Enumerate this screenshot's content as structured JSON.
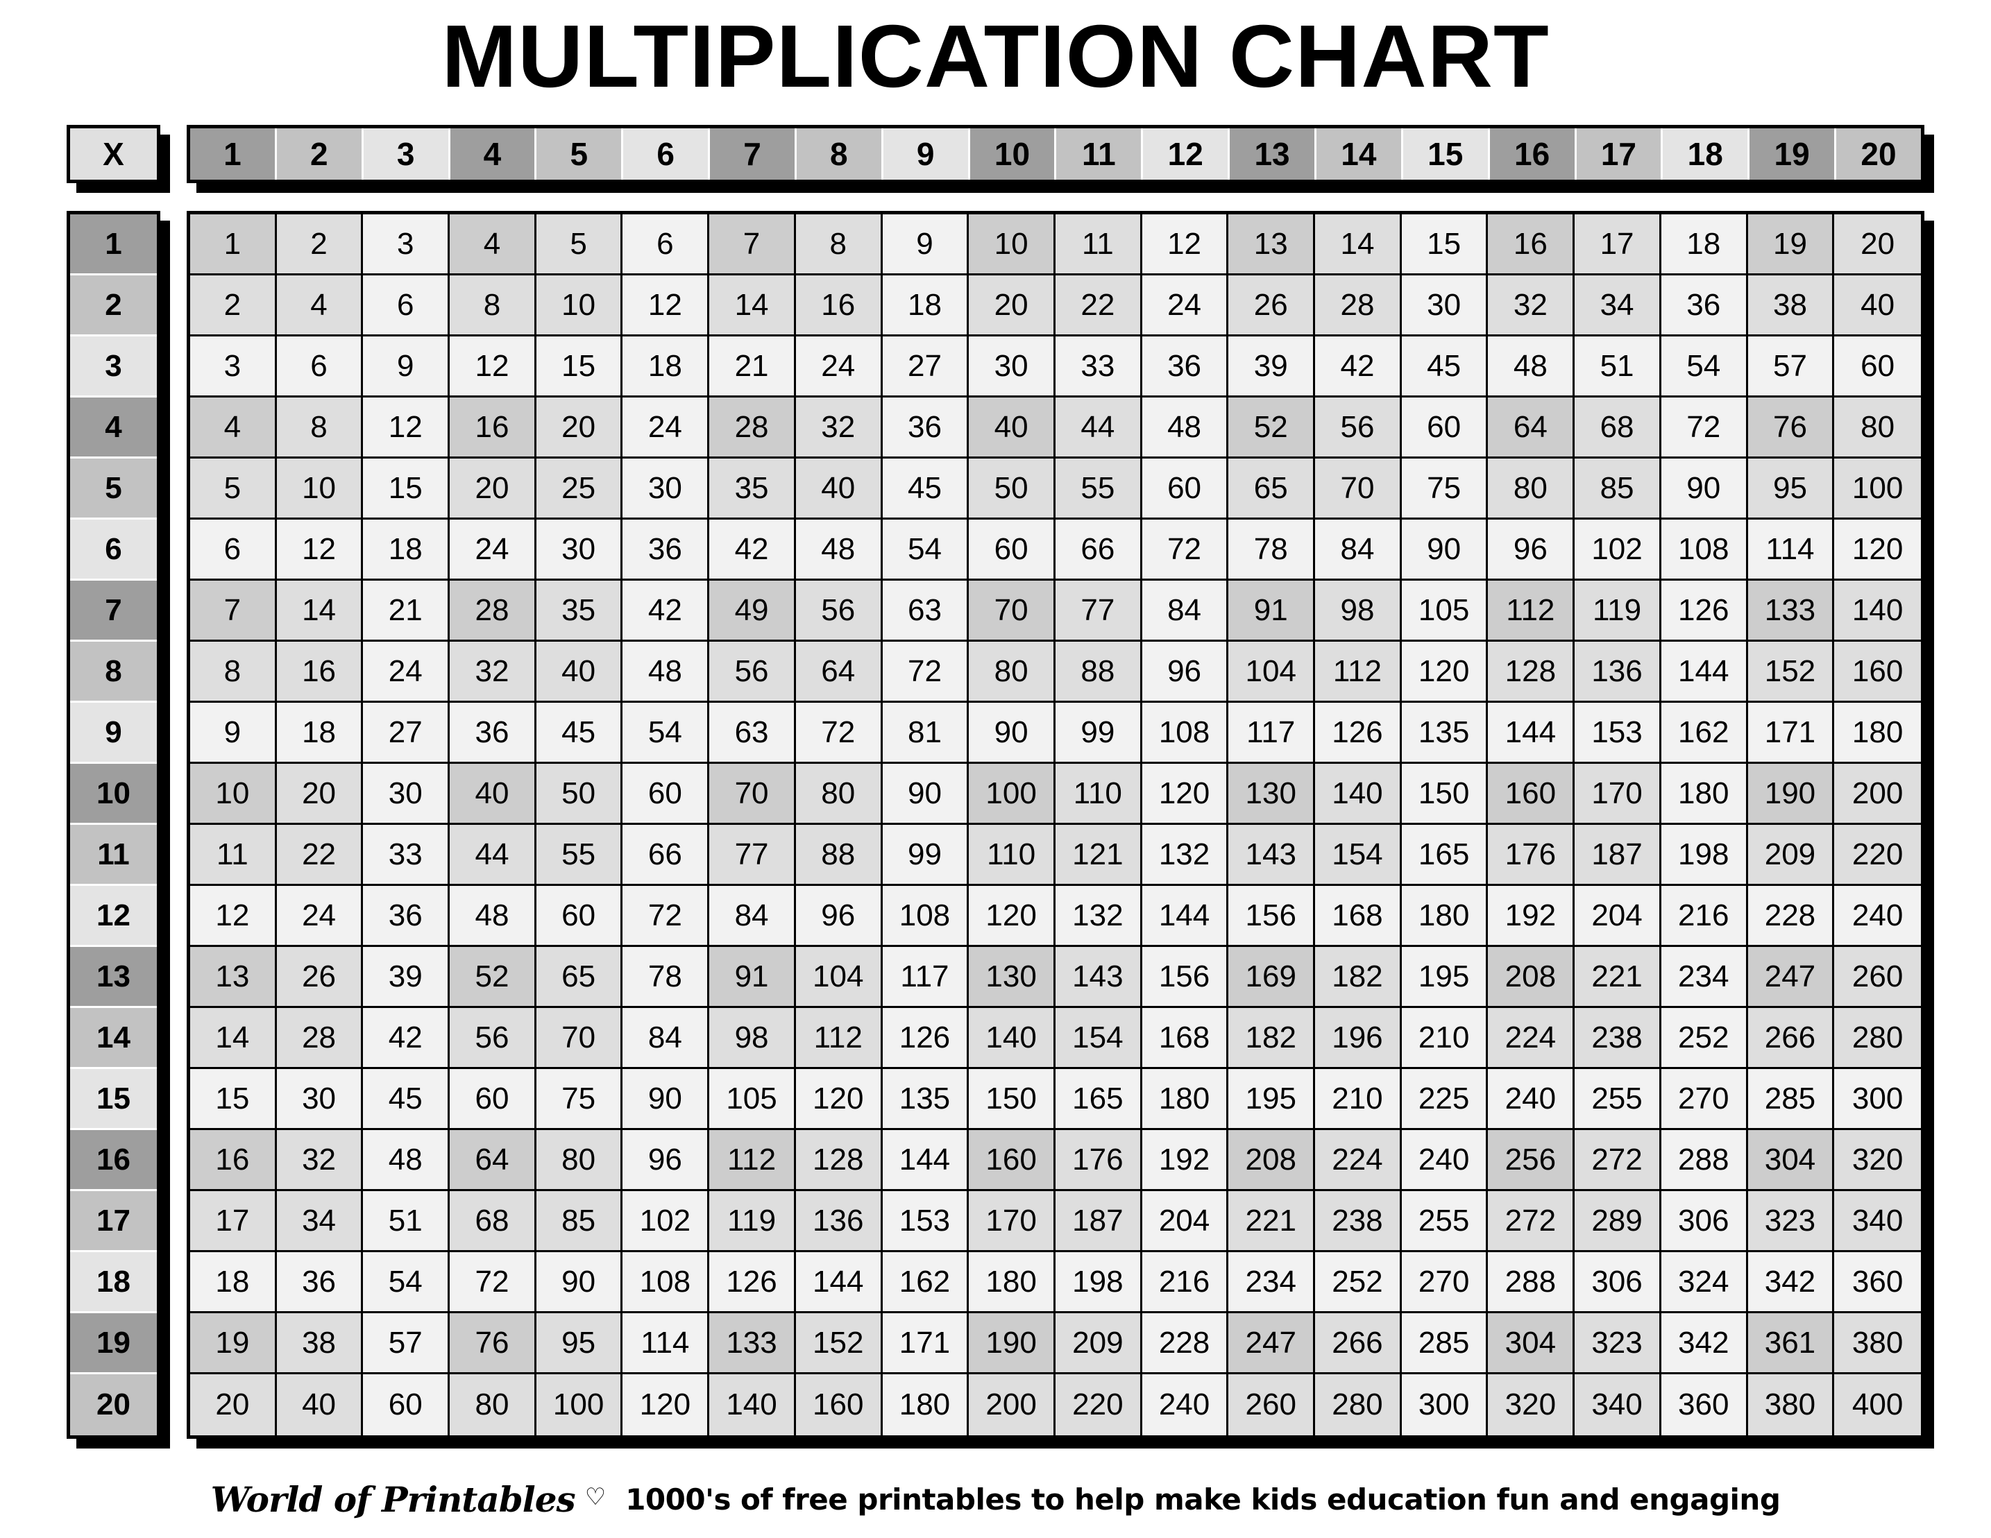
{
  "title": "MULTIPLICATION CHART",
  "corner_label": "X",
  "colors": {
    "header_dark": "#9e9e9e",
    "header_medium": "#c2c2c2",
    "header_light": "#e4e4e4",
    "cell_dark": "#cdcdcd",
    "cell_medium": "#dedede",
    "cell_light": "#f2f2f2",
    "border": "#000000",
    "page_background": "#ffffff"
  },
  "footer": {
    "brand": "World of Printables",
    "heart_icon": "heart-icon",
    "tagline": "1000's of free printables to help make kids education fun and engaging"
  },
  "chart_data": {
    "type": "table",
    "title": "MULTIPLICATION CHART",
    "xlabel": "",
    "ylabel": "",
    "corner": "X",
    "column_headers": [
      1,
      2,
      3,
      4,
      5,
      6,
      7,
      8,
      9,
      10,
      11,
      12,
      13,
      14,
      15,
      16,
      17,
      18,
      19,
      20
    ],
    "row_headers": [
      1,
      2,
      3,
      4,
      5,
      6,
      7,
      8,
      9,
      10,
      11,
      12,
      13,
      14,
      15,
      16,
      17,
      18,
      19,
      20
    ],
    "shading_rule": "tone level = max(row mod 3 rank, col mod 3 rank); rank 1 = darkest (n%3==1), 2 = medium (n%3==2), 3 = lightest (n%3==0)",
    "rows": [
      [
        1,
        2,
        3,
        4,
        5,
        6,
        7,
        8,
        9,
        10,
        11,
        12,
        13,
        14,
        15,
        16,
        17,
        18,
        19,
        20
      ],
      [
        2,
        4,
        6,
        8,
        10,
        12,
        14,
        16,
        18,
        20,
        22,
        24,
        26,
        28,
        30,
        32,
        34,
        36,
        38,
        40
      ],
      [
        3,
        6,
        9,
        12,
        15,
        18,
        21,
        24,
        27,
        30,
        33,
        36,
        39,
        42,
        45,
        48,
        51,
        54,
        57,
        60
      ],
      [
        4,
        8,
        12,
        16,
        20,
        24,
        28,
        32,
        36,
        40,
        44,
        48,
        52,
        56,
        60,
        64,
        68,
        72,
        76,
        80
      ],
      [
        5,
        10,
        15,
        20,
        25,
        30,
        35,
        40,
        45,
        50,
        55,
        60,
        65,
        70,
        75,
        80,
        85,
        90,
        95,
        100
      ],
      [
        6,
        12,
        18,
        24,
        30,
        36,
        42,
        48,
        54,
        60,
        66,
        72,
        78,
        84,
        90,
        96,
        102,
        108,
        114,
        120
      ],
      [
        7,
        14,
        21,
        28,
        35,
        42,
        49,
        56,
        63,
        70,
        77,
        84,
        91,
        98,
        105,
        112,
        119,
        126,
        133,
        140
      ],
      [
        8,
        16,
        24,
        32,
        40,
        48,
        56,
        64,
        72,
        80,
        88,
        96,
        104,
        112,
        120,
        128,
        136,
        144,
        152,
        160
      ],
      [
        9,
        18,
        27,
        36,
        45,
        54,
        63,
        72,
        81,
        90,
        99,
        108,
        117,
        126,
        135,
        144,
        153,
        162,
        171,
        180
      ],
      [
        10,
        20,
        30,
        40,
        50,
        60,
        70,
        80,
        90,
        100,
        110,
        120,
        130,
        140,
        150,
        160,
        170,
        180,
        190,
        200
      ],
      [
        11,
        22,
        33,
        44,
        55,
        66,
        77,
        88,
        99,
        110,
        121,
        132,
        143,
        154,
        165,
        176,
        187,
        198,
        209,
        220
      ],
      [
        12,
        24,
        36,
        48,
        60,
        72,
        84,
        96,
        108,
        120,
        132,
        144,
        156,
        168,
        180,
        192,
        204,
        216,
        228,
        240
      ],
      [
        13,
        26,
        39,
        52,
        65,
        78,
        91,
        104,
        117,
        130,
        143,
        156,
        169,
        182,
        195,
        208,
        221,
        234,
        247,
        260
      ],
      [
        14,
        28,
        42,
        56,
        70,
        84,
        98,
        112,
        126,
        140,
        154,
        168,
        182,
        196,
        210,
        224,
        238,
        252,
        266,
        280
      ],
      [
        15,
        30,
        45,
        60,
        75,
        90,
        105,
        120,
        135,
        150,
        165,
        180,
        195,
        210,
        225,
        240,
        255,
        270,
        285,
        300
      ],
      [
        16,
        32,
        48,
        64,
        80,
        96,
        112,
        128,
        144,
        160,
        176,
        192,
        208,
        224,
        240,
        256,
        272,
        288,
        304,
        320
      ],
      [
        17,
        34,
        51,
        68,
        85,
        102,
        119,
        136,
        153,
        170,
        187,
        204,
        221,
        238,
        255,
        272,
        289,
        306,
        323,
        340
      ],
      [
        18,
        36,
        54,
        72,
        90,
        108,
        126,
        144,
        162,
        180,
        198,
        216,
        234,
        252,
        270,
        288,
        306,
        324,
        342,
        360
      ],
      [
        19,
        38,
        57,
        76,
        95,
        114,
        133,
        152,
        171,
        190,
        209,
        228,
        247,
        266,
        285,
        304,
        323,
        342,
        361,
        380
      ],
      [
        20,
        40,
        60,
        80,
        100,
        120,
        140,
        160,
        180,
        200,
        220,
        240,
        260,
        280,
        300,
        320,
        340,
        360,
        380,
        400
      ]
    ]
  }
}
